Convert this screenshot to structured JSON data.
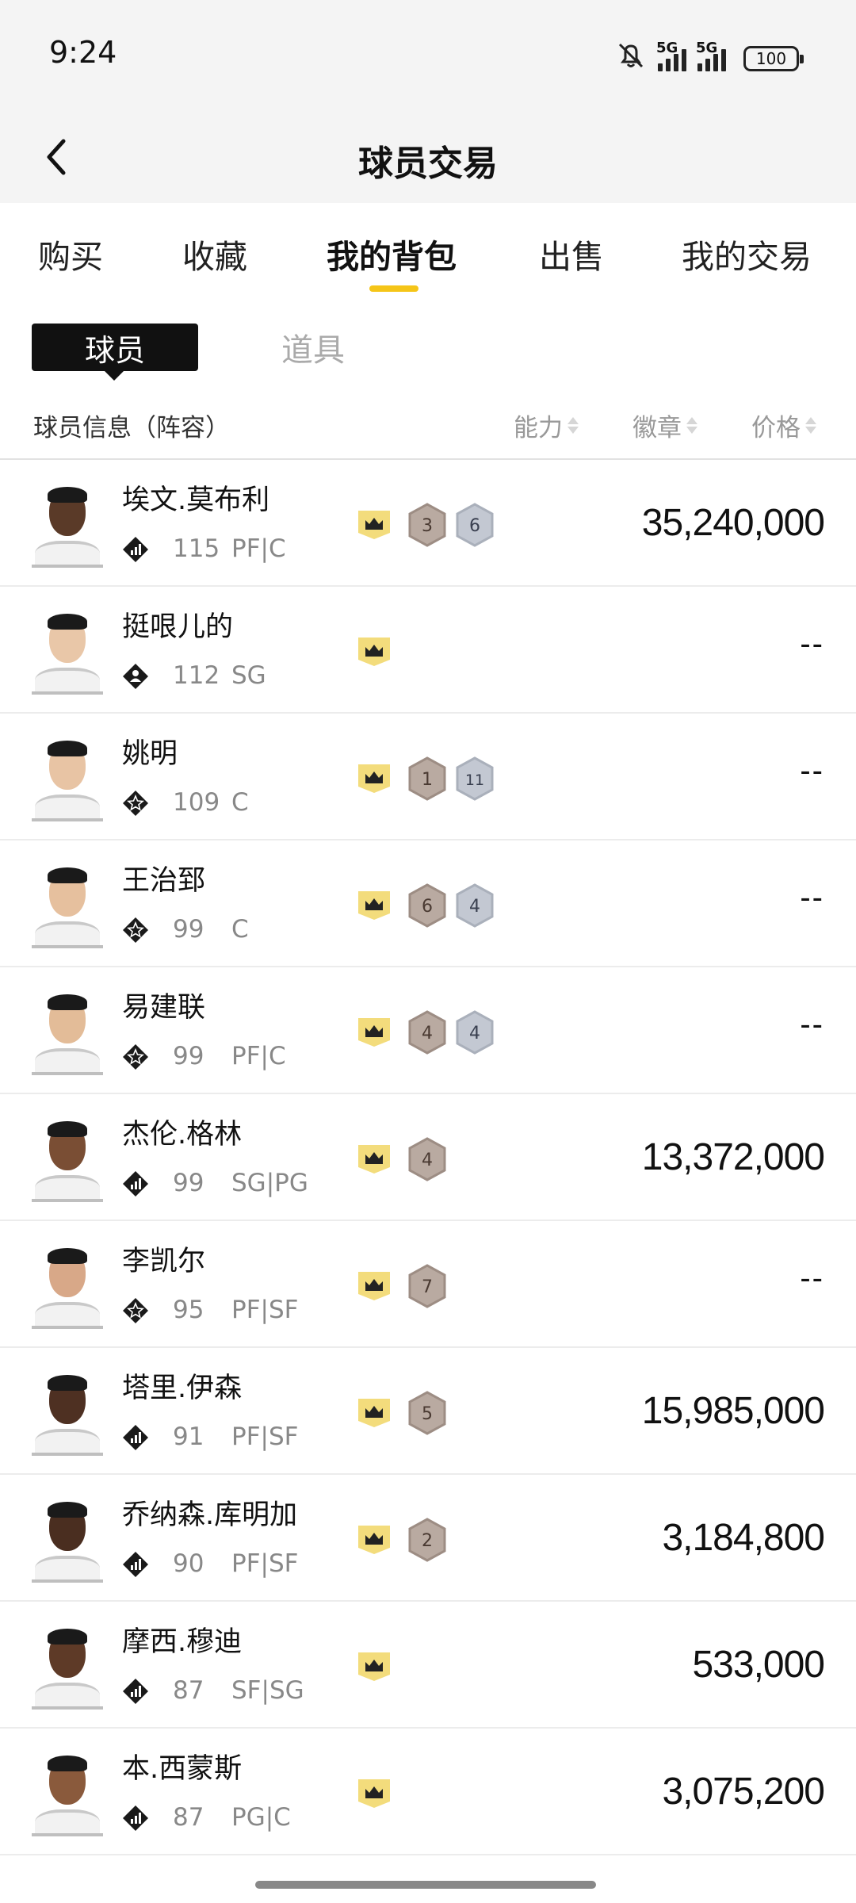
{
  "status": {
    "time": "9:24",
    "net1": "5G",
    "net2": "5G",
    "battery": "100"
  },
  "header": {
    "title": "球员交易"
  },
  "tabs": [
    "购买",
    "收藏",
    "我的背包",
    "出售",
    "我的交易"
  ],
  "active_tab": "我的背包",
  "subtabs": {
    "active": "球员",
    "inactive": "道具"
  },
  "columns": {
    "info": "球员信息（阵容）",
    "ability": "能力",
    "badge": "徽章",
    "price": "价格"
  },
  "colors": {
    "accent": "#f5c518",
    "crown_bg": "#f3dc7c",
    "bronze_badge": "#b9aaa1",
    "silver_badge": "#c3c8d2"
  },
  "players": [
    {
      "name": "埃文.莫布利",
      "ability": "115",
      "position": "PF|C",
      "tier_icon": "diamond-bars",
      "skin": "#5a3a28",
      "badges": [
        {
          "type": "bronze",
          "value": "3"
        },
        {
          "type": "silver",
          "value": "6"
        }
      ],
      "price": "35,240,000"
    },
    {
      "name": "挺哏儿的",
      "ability": "112",
      "position": "SG",
      "tier_icon": "diamond-person",
      "skin": "#e9c7a8",
      "badges": [],
      "price": "--"
    },
    {
      "name": "姚明",
      "ability": "109",
      "position": "C",
      "tier_icon": "diamond-star",
      "skin": "#e8c4a4",
      "badges": [
        {
          "type": "bronze",
          "value": "1"
        },
        {
          "type": "silver",
          "value": "11"
        }
      ],
      "price": "--"
    },
    {
      "name": "王治郅",
      "ability": "99",
      "position": "C",
      "tier_icon": "diamond-star",
      "skin": "#e6c09e",
      "badges": [
        {
          "type": "bronze",
          "value": "6"
        },
        {
          "type": "silver",
          "value": "4"
        }
      ],
      "price": "--"
    },
    {
      "name": "易建联",
      "ability": "99",
      "position": "PF|C",
      "tier_icon": "diamond-star",
      "skin": "#e3bc98",
      "badges": [
        {
          "type": "bronze",
          "value": "4"
        },
        {
          "type": "silver",
          "value": "4"
        }
      ],
      "price": "--"
    },
    {
      "name": "杰伦.格林",
      "ability": "99",
      "position": "SG|PG",
      "tier_icon": "diamond-bars",
      "skin": "#7a4e34",
      "badges": [
        {
          "type": "bronze",
          "value": "4"
        }
      ],
      "price": "13,372,000"
    },
    {
      "name": "李凯尔",
      "ability": "95",
      "position": "PF|SF",
      "tier_icon": "diamond-star",
      "skin": "#d8a888",
      "badges": [
        {
          "type": "bronze",
          "value": "7"
        }
      ],
      "price": "--"
    },
    {
      "name": "塔里.伊森",
      "ability": "91",
      "position": "PF|SF",
      "tier_icon": "diamond-bars",
      "skin": "#4e3022",
      "badges": [
        {
          "type": "bronze",
          "value": "5"
        }
      ],
      "price": "15,985,000"
    },
    {
      "name": "乔纳森.库明加",
      "ability": "90",
      "position": "PF|SF",
      "tier_icon": "diamond-bars",
      "skin": "#4a2e20",
      "badges": [
        {
          "type": "bronze",
          "value": "2"
        }
      ],
      "price": "3,184,800"
    },
    {
      "name": "摩西.穆迪",
      "ability": "87",
      "position": "SF|SG",
      "tier_icon": "diamond-bars",
      "skin": "#5e3a27",
      "badges": [],
      "price": "533,000"
    },
    {
      "name": "本.西蒙斯",
      "ability": "87",
      "position": "PG|C",
      "tier_icon": "diamond-bars",
      "skin": "#8a5a3c",
      "badges": [],
      "price": "3,075,200"
    }
  ]
}
